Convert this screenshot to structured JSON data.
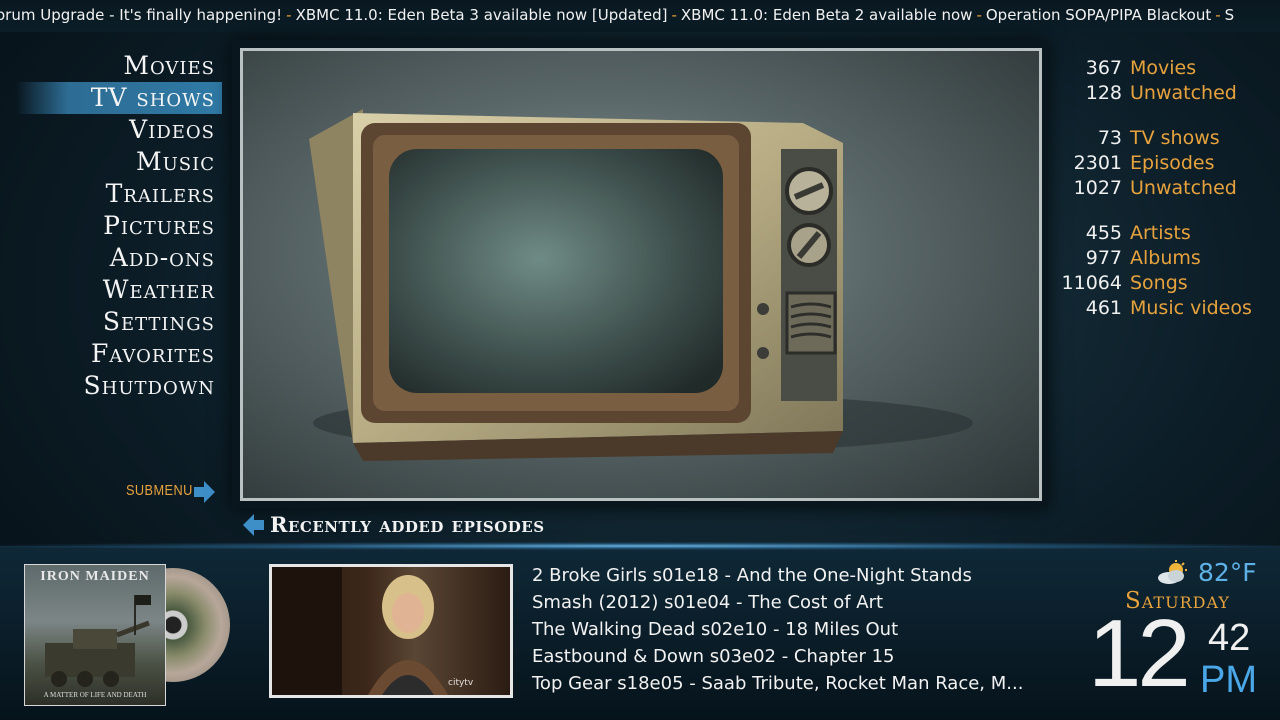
{
  "ticker": {
    "items": [
      "orum Upgrade - It's finally happening!",
      "XBMC 11.0: Eden Beta 3 available now [Updated]",
      "XBMC 11.0: Eden Beta 2 available now",
      "Operation SOPA/PIPA Blackout",
      "S"
    ]
  },
  "menu": {
    "items": [
      {
        "label": "Movies"
      },
      {
        "label": "TV shows",
        "selected": true
      },
      {
        "label": "Videos"
      },
      {
        "label": "Music"
      },
      {
        "label": "Trailers"
      },
      {
        "label": "Pictures"
      },
      {
        "label": "Add-ons"
      },
      {
        "label": "Weather"
      },
      {
        "label": "Settings"
      },
      {
        "label": "Favorites"
      },
      {
        "label": "Shutdown"
      }
    ],
    "submenu_label": "SUBMENU"
  },
  "stats": {
    "movies": {
      "count": "367",
      "label": "Movies"
    },
    "movies_unwatched": {
      "count": "128",
      "label": "Unwatched"
    },
    "tvshows": {
      "count": "73",
      "label": "TV shows"
    },
    "episodes": {
      "count": "2301",
      "label": "Episodes"
    },
    "episodes_unwatched": {
      "count": "1027",
      "label": "Unwatched"
    },
    "artists": {
      "count": "455",
      "label": "Artists"
    },
    "albums": {
      "count": "977",
      "label": "Albums"
    },
    "songs": {
      "count": "11064",
      "label": "Songs"
    },
    "music_videos": {
      "count": "461",
      "label": "Music videos"
    }
  },
  "recent": {
    "heading": "Recently added episodes",
    "episodes": [
      "2 Broke Girls s01e18 - And the One-Night Stands",
      "Smash (2012) s01e04 - The Cost of Art",
      "The Walking Dead s02e10 - 18 Miles Out",
      "Eastbound & Down s03e02 - Chapter 15",
      "Top Gear s18e05 - Saab Tribute, Rocket Man Race, M..."
    ]
  },
  "album_art": {
    "band": "IRON MAIDEN",
    "title": "A MATTER OF LIFE AND DEATH"
  },
  "thumb_logo": "citytv",
  "weather": {
    "icon": "partly-cloudy-icon",
    "temperature": "82°F",
    "day": "Saturday"
  },
  "clock": {
    "hour": "12",
    "minute": "42",
    "ampm": "PM"
  },
  "colors": {
    "accent": "#e8a23c",
    "highlight": "#2f7aa6",
    "clock_blue": "#4aa8e8"
  }
}
